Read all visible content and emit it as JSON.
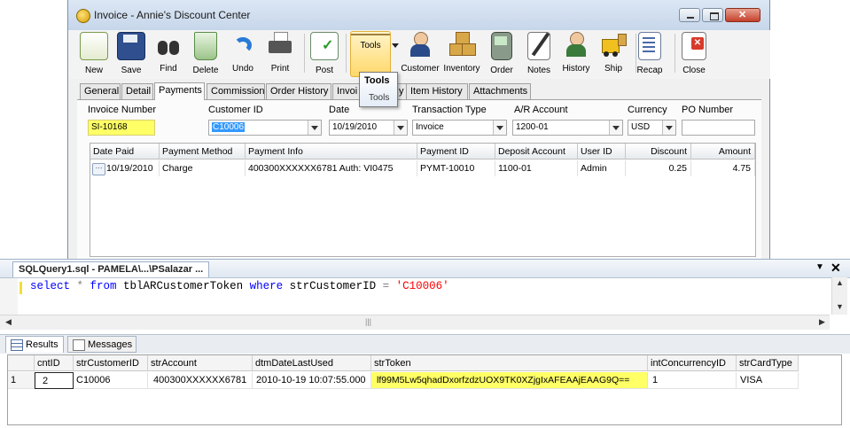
{
  "window": {
    "title": "Invoice - Annie's Discount Center"
  },
  "toolbar": {
    "items": [
      {
        "label": "New",
        "icon": "new-doc-icon"
      },
      {
        "label": "Save",
        "icon": "floppy-icon"
      },
      {
        "label": "Find",
        "icon": "binoculars-icon"
      },
      {
        "label": "Delete",
        "icon": "recycle-bin-icon"
      },
      {
        "label": "Undo",
        "icon": "undo-arrow-icon"
      },
      {
        "label": "Print",
        "icon": "printer-icon"
      },
      {
        "label": "Post",
        "icon": "post-checklist-icon"
      },
      {
        "label": "Tools",
        "icon": "tools-icon"
      },
      {
        "label": "Customer",
        "icon": "customer-icon"
      },
      {
        "label": "Inventory",
        "icon": "inventory-boxes-icon"
      },
      {
        "label": "Order",
        "icon": "order-device-icon"
      },
      {
        "label": "Notes",
        "icon": "notes-pen-icon"
      },
      {
        "label": "History",
        "icon": "history-icon"
      },
      {
        "label": "Ship",
        "icon": "forklift-icon"
      },
      {
        "label": "Recap",
        "icon": "recap-doc-icon"
      },
      {
        "label": "Close",
        "icon": "close-doc-icon"
      }
    ]
  },
  "tooltip": {
    "title": "Tools",
    "description": "Tools"
  },
  "tabs": [
    "General",
    "Detail",
    "Payments",
    "Commission",
    "Order History",
    "Invoi",
    "y",
    "Item History",
    "Attachments"
  ],
  "form": {
    "invoice_number_label": "Invoice Number",
    "invoice_number": "SI-10168",
    "customer_id_label": "Customer ID",
    "customer_id": "C10006",
    "date_label": "Date",
    "date": "10/19/2010",
    "transaction_type_label": "Transaction Type",
    "transaction_type": "Invoice",
    "ar_account_label": "A/R Account",
    "ar_account": "1200-01",
    "currency_label": "Currency",
    "currency": "USD",
    "po_number_label": "PO Number",
    "po_number": ""
  },
  "payments": {
    "columns": [
      "Date Paid",
      "Payment Method",
      "Payment Info",
      "Payment ID",
      "Deposit Account",
      "User ID",
      "Discount",
      "Amount"
    ],
    "rows": [
      [
        "10/19/2010",
        "Charge",
        "400300XXXXXX6781 Auth: VI0475",
        "PYMT-10010",
        "1100-01",
        "Admin",
        "0.25",
        "4.75"
      ]
    ]
  },
  "sql": {
    "tab_title": "SQLQuery1.sql - PAMELA\\...\\PSalazar ...",
    "tokens": [
      "select",
      " * ",
      "from",
      " tblARCustomerToken ",
      "where",
      " strCustomerID ",
      "=",
      " ",
      "'C10006'"
    ]
  },
  "results": {
    "tabs": [
      "Results",
      "Messages"
    ],
    "columns": [
      "cntID",
      "strCustomerID",
      "strAccount",
      "dtmDateLastUsed",
      "strToken",
      "intConcurrencyID",
      "strCardType"
    ],
    "rows": [
      [
        "1",
        "2",
        "C10006",
        "400300XXXXXX6781",
        "2010-10-19 10:07:55.000",
        "lf99M5Lw5qhadDxorfzdzUOX9TK0XZjgIxAFEAAjEAAG9Q==",
        "1",
        "VISA"
      ]
    ]
  }
}
